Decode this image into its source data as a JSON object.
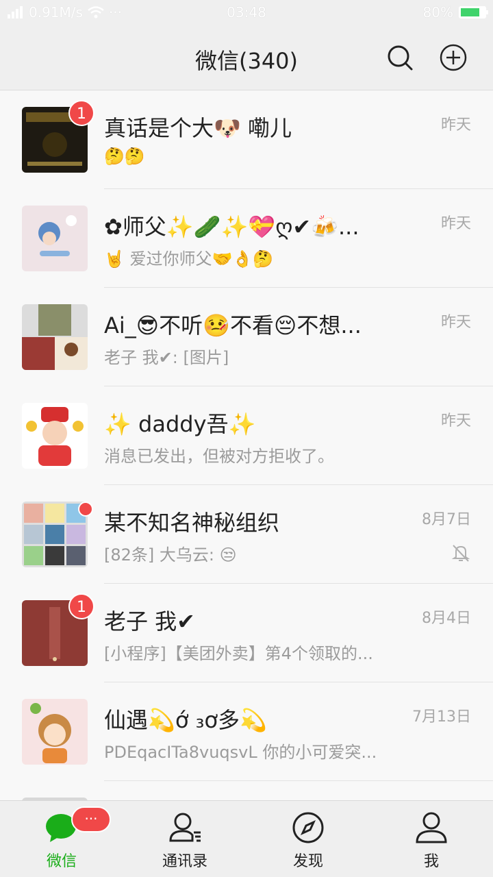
{
  "status": {
    "speed": "0.91M/s",
    "more": "···",
    "time": "03:48",
    "battery": "80%",
    "battery_level": 0.8
  },
  "nav": {
    "title": "微信(340)"
  },
  "chats": [
    {
      "name": "真话是个大🐶 嘞儿",
      "preview": "🤔🤔",
      "time": "昨天",
      "badge": "1"
    },
    {
      "name": "✿师父✨🥒✨💝ღ✔🍻...",
      "preview": "🤘 爱过你师父🤝👌🤔",
      "time": "昨天"
    },
    {
      "name": "Ai_😎不听🤒不看😔不想...",
      "preview": "老子 我✔: [图片]",
      "time": "昨天"
    },
    {
      "name": "✨ daddy吾✨",
      "preview": "消息已发出，但被对方拒收了。",
      "time": "昨天"
    },
    {
      "name": "某不知名神秘组织",
      "preview": "[82条] 大乌云: 😒",
      "time": "8月7日",
      "muted": true
    },
    {
      "name": "老子 我✔",
      "preview": "[小程序]【美团外卖】第4个领取的...",
      "time": "8月4日",
      "badge": "1"
    },
    {
      "name": "仙遇💫ớ ₃ơ多💫",
      "preview": "PDEqacITa8vuqsvL 你的小可爱突...",
      "time": "7月13日"
    }
  ],
  "tabs": [
    {
      "label": "微信",
      "icon": "chat-bubble-icon",
      "active": true,
      "badge": "···"
    },
    {
      "label": "通讯录",
      "icon": "contacts-icon"
    },
    {
      "label": "发现",
      "icon": "compass-icon"
    },
    {
      "label": "我",
      "icon": "person-icon"
    }
  ],
  "colors": {
    "accent": "#1aad19",
    "badge": "#f04848"
  }
}
